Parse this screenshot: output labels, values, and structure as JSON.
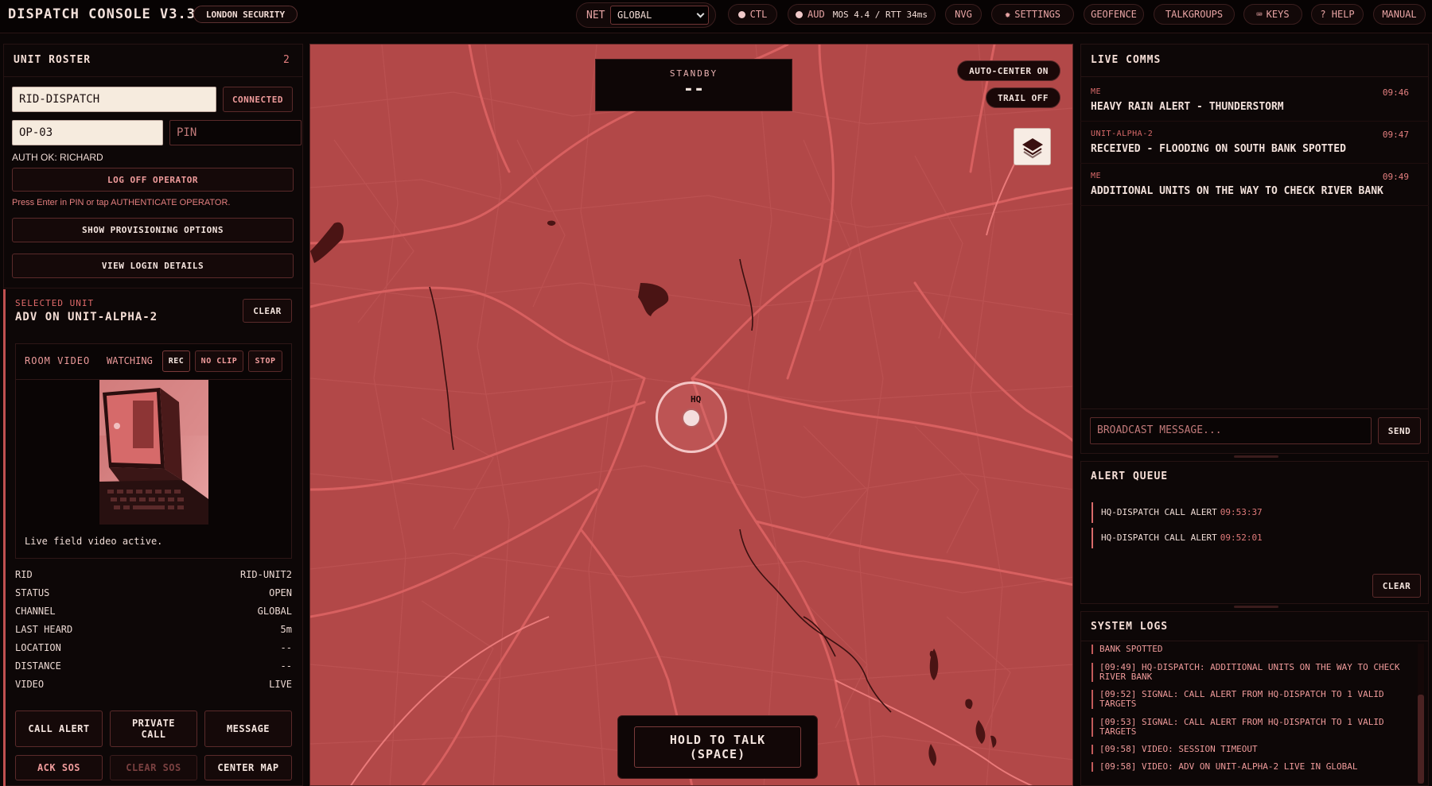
{
  "app": {
    "title": "DISPATCH CONSOLE V3.3",
    "org_badge": "LONDON SECURITY"
  },
  "topbar": {
    "net_label": "NET",
    "net_value": "GLOBAL",
    "ctl_label": "CTL",
    "aud_label": "AUD",
    "aud_stats": "MOS 4.4 / RTT 34ms",
    "nvg_label": "NVG",
    "settings_label": "SETTINGS",
    "geofence_label": "GEOFENCE",
    "talkgroups_label": "TALKGROUPS",
    "keys_label": "KEYS",
    "help_label": "? HELP",
    "manual_label": "MANUAL"
  },
  "roster": {
    "title": "UNIT ROSTER",
    "count": "2",
    "rid_value": "RID-DISPATCH",
    "connection_status": "CONNECTED",
    "operator_value": "OP-03",
    "pin_placeholder": "PIN",
    "auth_status": "AUTH OK: RICHARD",
    "logoff_label": "LOG OFF OPERATOR",
    "hint": "Press Enter in PIN or tap AUTHENTICATE OPERATOR.",
    "provisioning_label": "SHOW PROVISIONING OPTIONS",
    "login_details_label": "VIEW LOGIN DETAILS"
  },
  "selected_unit": {
    "label": "SELECTED UNIT",
    "title": "ADV ON UNIT-ALPHA-2",
    "clear_label": "CLEAR",
    "video": {
      "title": "ROOM VIDEO",
      "status": "WATCHING",
      "rec_label": "REC",
      "noclip_label": "NO CLIP",
      "stop_label": "STOP",
      "caption": "Live field video active."
    },
    "details": [
      {
        "key": "RID",
        "value": "RID-UNIT2"
      },
      {
        "key": "STATUS",
        "value": "OPEN"
      },
      {
        "key": "CHANNEL",
        "value": "GLOBAL"
      },
      {
        "key": "LAST HEARD",
        "value": "5m"
      },
      {
        "key": "LOCATION",
        "value": "--"
      },
      {
        "key": "DISTANCE",
        "value": "--"
      },
      {
        "key": "VIDEO",
        "value": "LIVE"
      }
    ],
    "actions": {
      "call_alert": "CALL ALERT",
      "private_call": "PRIVATE CALL",
      "message": "MESSAGE",
      "ack_sos": "ACK SOS",
      "clear_sos": "CLEAR SOS",
      "center_map": "CENTER MAP"
    }
  },
  "map": {
    "standby_label": "STANDBY",
    "standby_value": "--",
    "auto_center_label": "AUTO-CENTER ON",
    "trail_label": "TRAIL OFF",
    "hq_label": "HQ",
    "ptt_label": "HOLD TO TALK (SPACE)"
  },
  "comms": {
    "title": "LIVE COMMS",
    "items": [
      {
        "sender": "ME",
        "time": "09:46",
        "text": "HEAVY RAIN ALERT - THUNDERSTORM"
      },
      {
        "sender": "UNIT-ALPHA-2",
        "time": "09:47",
        "text": "RECEIVED - FLOODING ON SOUTH BANK SPOTTED"
      },
      {
        "sender": "ME",
        "time": "09:49",
        "text": "ADDITIONAL UNITS ON THE WAY TO CHECK RIVER BANK"
      }
    ],
    "broadcast_placeholder": "BROADCAST MESSAGE...",
    "send_label": "SEND"
  },
  "alerts": {
    "title": "ALERT QUEUE",
    "items": [
      {
        "text": "HQ-DISPATCH CALL ALERT",
        "time": "09:53:37"
      },
      {
        "text": "HQ-DISPATCH CALL ALERT",
        "time": "09:52:01"
      }
    ],
    "clear_label": "CLEAR"
  },
  "logs": {
    "title": "SYSTEM LOGS",
    "items": [
      "BANK SPOTTED",
      "[09:49] HQ-DISPATCH: ADDITIONAL UNITS ON THE WAY TO CHECK RIVER BANK",
      "[09:52] SIGNAL: CALL ALERT FROM HQ-DISPATCH TO 1 VALID TARGETS",
      "[09:53] SIGNAL: CALL ALERT FROM HQ-DISPATCH TO 1 VALID TARGETS",
      "[09:58] VIDEO: SESSION TIMEOUT",
      "[09:58] VIDEO: ADV ON UNIT-ALPHA-2 LIVE IN GLOBAL"
    ]
  },
  "colors": {
    "accent": "#e46a6a",
    "map_tint": "#b24848",
    "panel": "#0d0707"
  }
}
